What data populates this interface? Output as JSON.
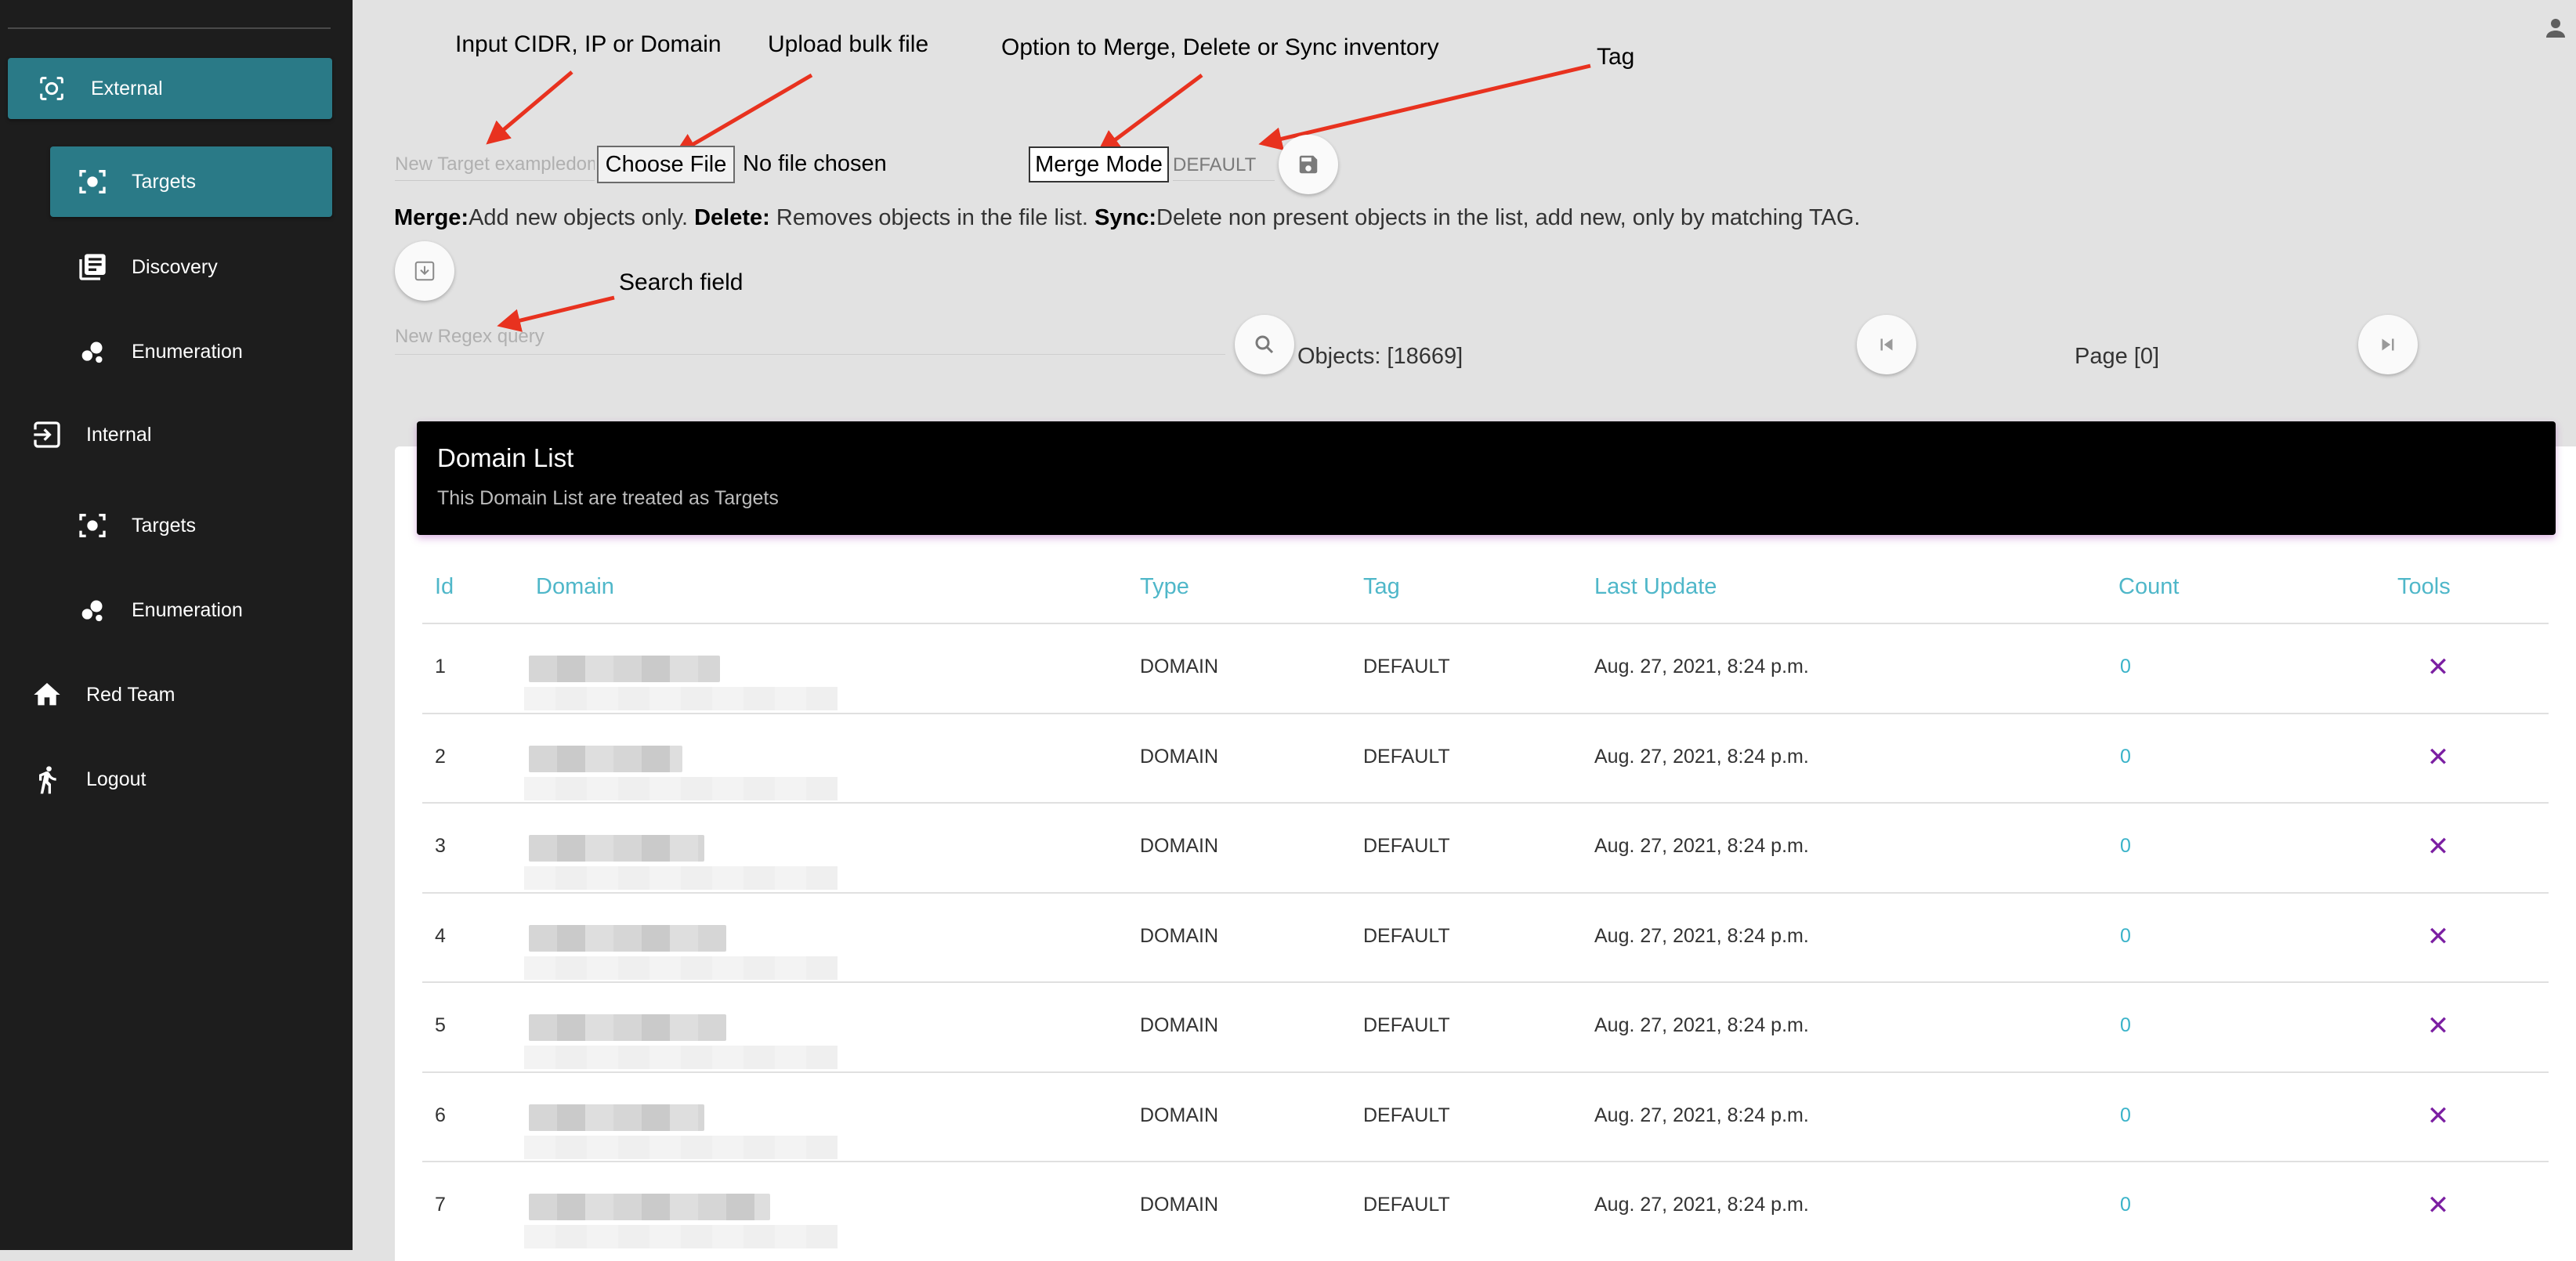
{
  "sidebar": {
    "items": [
      {
        "label": "External",
        "icon": "scan-icon"
      },
      {
        "label": "Targets",
        "icon": "target-scan-icon"
      },
      {
        "label": "Discovery",
        "icon": "library-books-icon"
      },
      {
        "label": "Enumeration",
        "icon": "bubble-chart-icon"
      },
      {
        "label": "Internal",
        "icon": "input-icon"
      },
      {
        "label": "Targets",
        "icon": "target-scan-icon"
      },
      {
        "label": "Enumeration",
        "icon": "bubble-chart-icon"
      },
      {
        "label": "Red Team",
        "icon": "home-icon"
      },
      {
        "label": "Logout",
        "icon": "run-icon"
      }
    ]
  },
  "annotations": {
    "input": "Input CIDR, IP or Domain",
    "upload": "Upload bulk file",
    "merge": "Option to Merge, Delete or Sync inventory",
    "tag": "Tag",
    "search": "Search field"
  },
  "toolbar": {
    "target_placeholder": "New Target exampledomain.com",
    "choose_file_label": "Choose File",
    "no_file_text": "No file chosen",
    "merge_label": "Merge Mode",
    "tag_value": "DEFAULT",
    "info": {
      "merge_key": "Merge:",
      "merge_text": "Add new objects only. ",
      "delete_key": "Delete:",
      "delete_text": " Removes objects in the file list. ",
      "sync_key": "Sync:",
      "sync_text": "Delete non present objects in the list, add new, only by matching TAG."
    },
    "regex_placeholder": "New Regex query",
    "objects_text": "Objects: [18669]",
    "page_text": "Page [0]"
  },
  "card": {
    "title": "Domain List",
    "subtitle": "This Domain List are treated as Targets"
  },
  "table": {
    "headers": [
      "Id",
      "Domain",
      "Type",
      "Tag",
      "Last Update",
      "Count",
      "Tools"
    ],
    "rows": [
      {
        "id": "1",
        "type": "DOMAIN",
        "tag": "DEFAULT",
        "updated": "Aug. 27, 2021, 8:24 p.m.",
        "count": "0"
      },
      {
        "id": "2",
        "type": "DOMAIN",
        "tag": "DEFAULT",
        "updated": "Aug. 27, 2021, 8:24 p.m.",
        "count": "0"
      },
      {
        "id": "3",
        "type": "DOMAIN",
        "tag": "DEFAULT",
        "updated": "Aug. 27, 2021, 8:24 p.m.",
        "count": "0"
      },
      {
        "id": "4",
        "type": "DOMAIN",
        "tag": "DEFAULT",
        "updated": "Aug. 27, 2021, 8:24 p.m.",
        "count": "0"
      },
      {
        "id": "5",
        "type": "DOMAIN",
        "tag": "DEFAULT",
        "updated": "Aug. 27, 2021, 8:24 p.m.",
        "count": "0"
      },
      {
        "id": "6",
        "type": "DOMAIN",
        "tag": "DEFAULT",
        "updated": "Aug. 27, 2021, 8:24 p.m.",
        "count": "0"
      },
      {
        "id": "7",
        "type": "DOMAIN",
        "tag": "DEFAULT",
        "updated": "Aug. 27, 2021, 8:24 p.m.",
        "count": "0"
      }
    ],
    "delete_glyph": "✕"
  },
  "colors": {
    "sidebar_bg": "#1d1d1d",
    "active_item": "#2a7a87",
    "header_text": "#4fb7c9",
    "delete_icon": "#7b1fa2",
    "annotation_arrow": "#e8321f"
  }
}
